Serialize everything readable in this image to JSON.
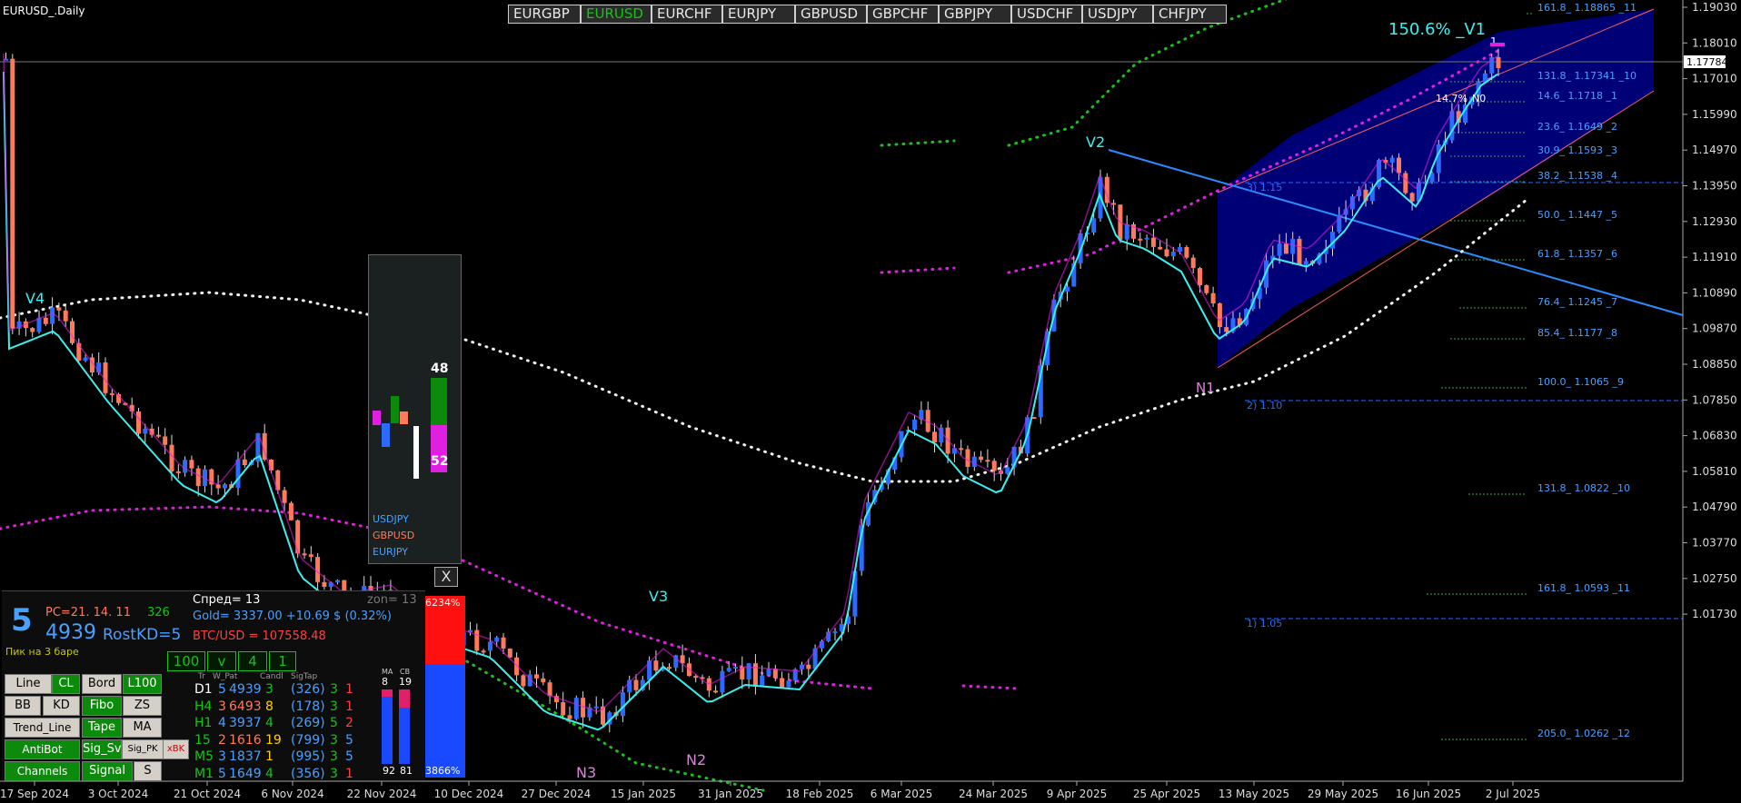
{
  "window_title": "EURUSD_.Daily",
  "symbol_tabs": [
    {
      "label": "EURGBP",
      "active": false
    },
    {
      "label": "EURUSD",
      "active": true
    },
    {
      "label": "EURCHF",
      "active": false
    },
    {
      "label": "EURJPY",
      "active": false
    },
    {
      "label": "GBPUSD",
      "active": false
    },
    {
      "label": "GBPCHF",
      "active": false
    },
    {
      "label": "GBPJPY",
      "active": false
    },
    {
      "label": "USDCHF",
      "active": false
    },
    {
      "label": "USDJPY",
      "active": false
    },
    {
      "label": "CHFJPY",
      "active": false
    }
  ],
  "price_axis": {
    "labels": [
      "1.19030",
      "1.18010",
      "1.17010",
      "1.15990",
      "1.14970",
      "1.13950",
      "1.12930",
      "1.11910",
      "1.10890",
      "1.09870",
      "1.08850",
      "1.07850",
      "1.06830",
      "1.05810",
      "1.04790",
      "1.03770",
      "1.02750",
      "1.01730"
    ],
    "current_price": "1.17784"
  },
  "time_axis": [
    "17 Sep 2024",
    "3 Oct 2024",
    "21 Oct 2024",
    "6 Nov 2024",
    "22 Nov 2024",
    "10 Dec 2024",
    "27 Dec 2024",
    "15 Jan 2025",
    "31 Jan 2025",
    "18 Feb 2025",
    "6 Mar 2025",
    "24 Mar 2025",
    "9 Apr 2025",
    "25 Apr 2025",
    "13 May 2025",
    "29 May 2025",
    "16 Jun 2025",
    "2 Jul 2025"
  ],
  "fib_levels": [
    "161.8_ 1.18865 _11",
    "131.8_ 1.17341 _10",
    "14.6_ 1.1718 _1",
    "23.6_ 1.1649 _2",
    "30.9_ 1.1593 _3",
    "38.2_ 1.1538 _4",
    "50.0_ 1.1447 _5",
    "61.8_ 1.1357 _6",
    "76.4_ 1.1245 _7",
    "85.4_ 1.1177 _8",
    "100.0_ 1.1065 _9",
    "131.8_ 1.0822 _10",
    "161.8_ 1.0593 _11",
    "205.0_ 1.0262 _12"
  ],
  "channel_levels": [
    "3)  1.15",
    "2)  1.10",
    "1)  1.05"
  ],
  "wave_labels": {
    "v1": "150.6% _V1",
    "v2": "V2",
    "v3": "V3",
    "v4": "V4",
    "n0": "N0",
    "n1": "N1",
    "n2": "N2",
    "n3": "N3",
    "pct_n0": "14.7%",
    "one": "1"
  },
  "mini_panel": {
    "top_value": "48",
    "bottom_value": "52",
    "pairs": [
      "USDJPY",
      "GBPUSD",
      "EURJPY"
    ],
    "close_label": "X"
  },
  "info_panel": {
    "big_digit": "5",
    "big_number": "4939",
    "rostkd": "RostKD=5",
    "pc": "PC=21. 14. 11",
    "pc_count": "326",
    "pik": "Пик на 3 баре",
    "spread": "Спред= 13",
    "zon": "zon= 13",
    "gold": "Gold= 3337.00 +10.69 $ (0.32%)",
    "btc": "BTC/USD = 107558.48",
    "bar_top": "6234%",
    "bar_bottom": "3866%",
    "ma_label": "MA",
    "cb_label": "CB",
    "ma_val": "8",
    "cb_val": "19",
    "bottom_left": "92",
    "bottom_mid": "81",
    "toggles": [
      "100",
      "v",
      "4",
      "1"
    ],
    "table_header": [
      "Tr",
      "W_Pat",
      "Candl",
      "SigTap"
    ],
    "rows": [
      {
        "tf": "D1",
        "tr": "5",
        "w": "4939",
        "p": "3",
        "c": "(326)",
        "s1": "3",
        "s2": "1"
      },
      {
        "tf": "H4",
        "tr": "3",
        "w": "6493",
        "p": "8",
        "c": "(178)",
        "s1": "3",
        "s2": "1"
      },
      {
        "tf": "H1",
        "tr": "4",
        "w": "3937",
        "p": "4",
        "c": "(269)",
        "s1": "5",
        "s2": "2"
      },
      {
        "tf": "15",
        "tr": "2",
        "w": "1616",
        "p": "19",
        "c": "(799)",
        "s1": "3",
        "s2": "5"
      },
      {
        "tf": "M5",
        "tr": "3",
        "w": "1837",
        "p": "1",
        "c": "(995)",
        "s1": "3",
        "s2": "5"
      },
      {
        "tf": "M1",
        "tr": "5",
        "w": "1649",
        "p": "4",
        "c": "(356)",
        "s1": "3",
        "s2": "1"
      }
    ],
    "buttons": [
      "Line",
      "CL",
      "Bord",
      "L100",
      "BB",
      "KD",
      "Fibo",
      "ZS",
      "Trend_Line",
      "Tape",
      "MA",
      "AntiBot",
      "Sig_Sv",
      "Sig_PK",
      "xBK",
      "Channels",
      "Signal",
      "S"
    ]
  },
  "colors": {
    "bull": "#2a6cff",
    "bear": "#ff7a5a",
    "cyan": "#3cf0f0",
    "magenta": "#e020e0",
    "green": "#19c219",
    "channel": "#000080",
    "fib": "#4aa0ff"
  }
}
